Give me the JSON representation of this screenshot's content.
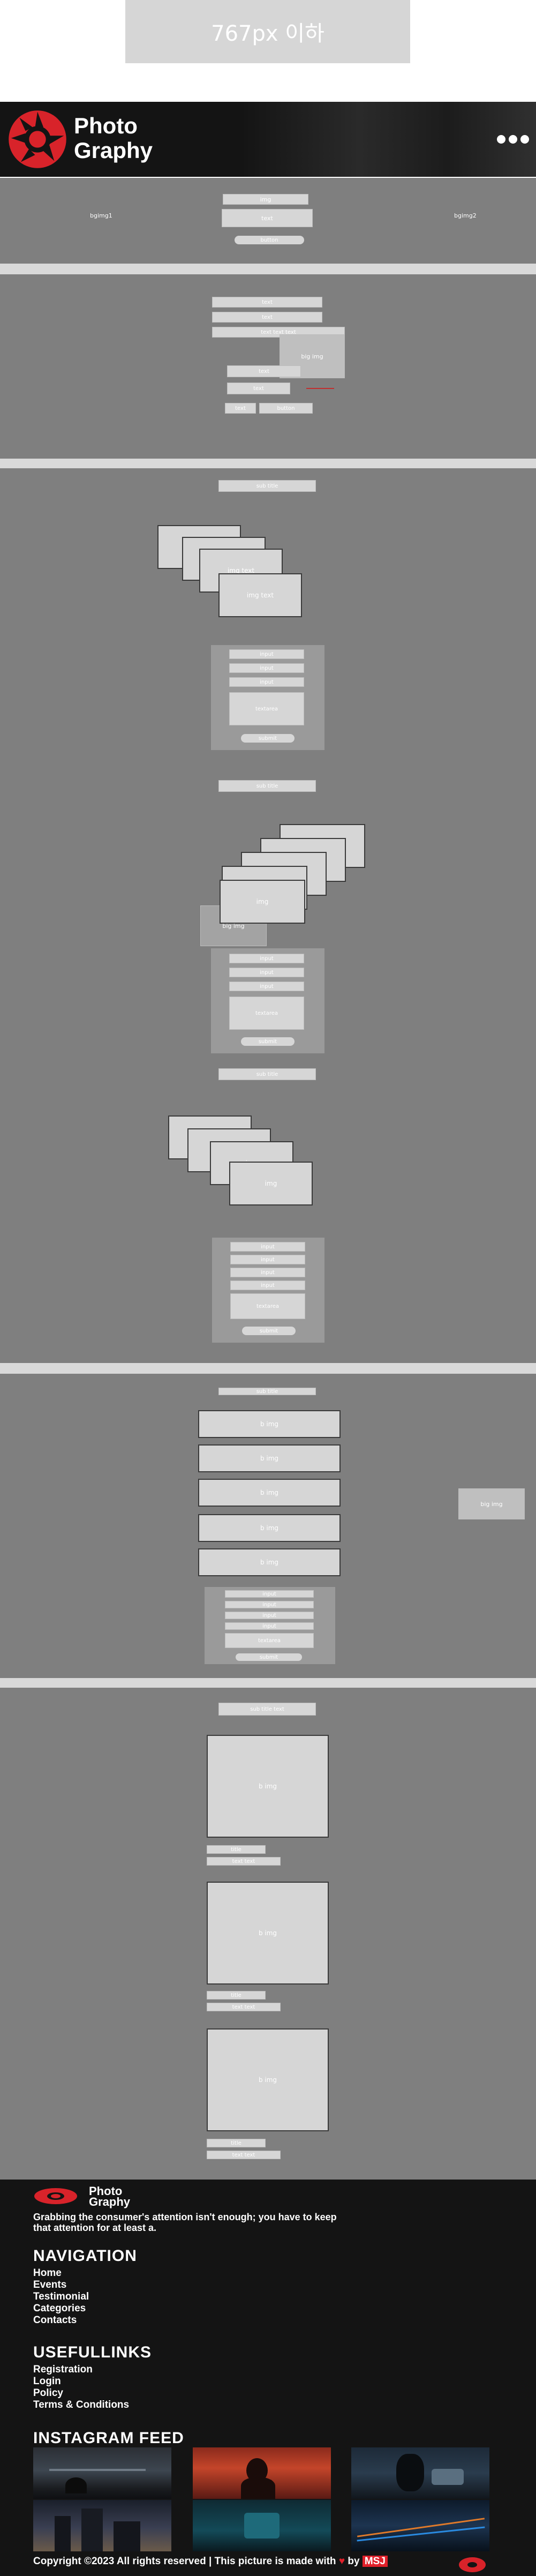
{
  "page_label": "767px 이하",
  "header": {
    "logo_line1": "Photo",
    "logo_line2": "Graphy",
    "menu_icon": "more-dots-icon"
  },
  "section1": {
    "left_label": "bgimg1",
    "right_label": "bgimg2",
    "top_box": "img",
    "mid_box": "text",
    "button": "button"
  },
  "section2": {
    "fields": [
      "text",
      "text",
      "text text text",
      "text",
      "text",
      "text"
    ],
    "img_label": "big img",
    "buttons": [
      "text",
      "button"
    ]
  },
  "section3": {
    "title_a": "sub title",
    "cards_a": [
      "img text",
      "img text",
      "img text",
      "img text"
    ],
    "form_a": [
      "input",
      "input",
      "input",
      "textarea"
    ],
    "submit_a": "submit",
    "title_b": "sub title",
    "cards_b": [
      "img",
      "img",
      "img",
      "img",
      "img"
    ],
    "side_label": "big img",
    "form_b": [
      "input",
      "input",
      "input",
      "textarea"
    ],
    "submit_b": "submit",
    "title_c": "sub title",
    "cards_c": [
      "img",
      "img",
      "img",
      "img"
    ],
    "form_c": [
      "input",
      "input",
      "input",
      "input",
      "textarea"
    ],
    "submit_c": "submit"
  },
  "section4": {
    "title": "sub title",
    "rows": [
      "b img",
      "b img",
      "b img",
      "b img",
      "b img"
    ],
    "side_label": "big img",
    "form": [
      "input",
      "input",
      "input",
      "input",
      "textarea"
    ],
    "submit": "submit"
  },
  "section5": {
    "title": "sub title text",
    "items": [
      {
        "img": "b img",
        "l1": "title",
        "l2": "text text"
      },
      {
        "img": "b img",
        "l1": "title",
        "l2": "text text"
      },
      {
        "img": "b img",
        "l1": "title",
        "l2": "text text"
      }
    ]
  },
  "footer": {
    "logo_line1": "Photo",
    "logo_line2": "Graphy",
    "tagline": "Grabbing the consumer's attention isn't enough; you have to keep that attention for at least a.",
    "nav_title": "NAVIGATION",
    "nav_items": [
      "Home",
      "Events",
      "Testimonial",
      "Categories",
      "Contacts"
    ],
    "useful_title": "USEFULLINKS",
    "useful_items": [
      "Registration",
      "Login",
      "Policy",
      "Terms & Conditions"
    ],
    "insta_title": "INSTAGRAM FEED",
    "copyright_a": "Copyright ©2023 All rights reserved | This picture is made with",
    "copyright_b": "by",
    "brand": "MSJ",
    "colors": {
      "accent": "#e0202a",
      "bg": "#141414",
      "section": "#7f7f7f"
    }
  }
}
